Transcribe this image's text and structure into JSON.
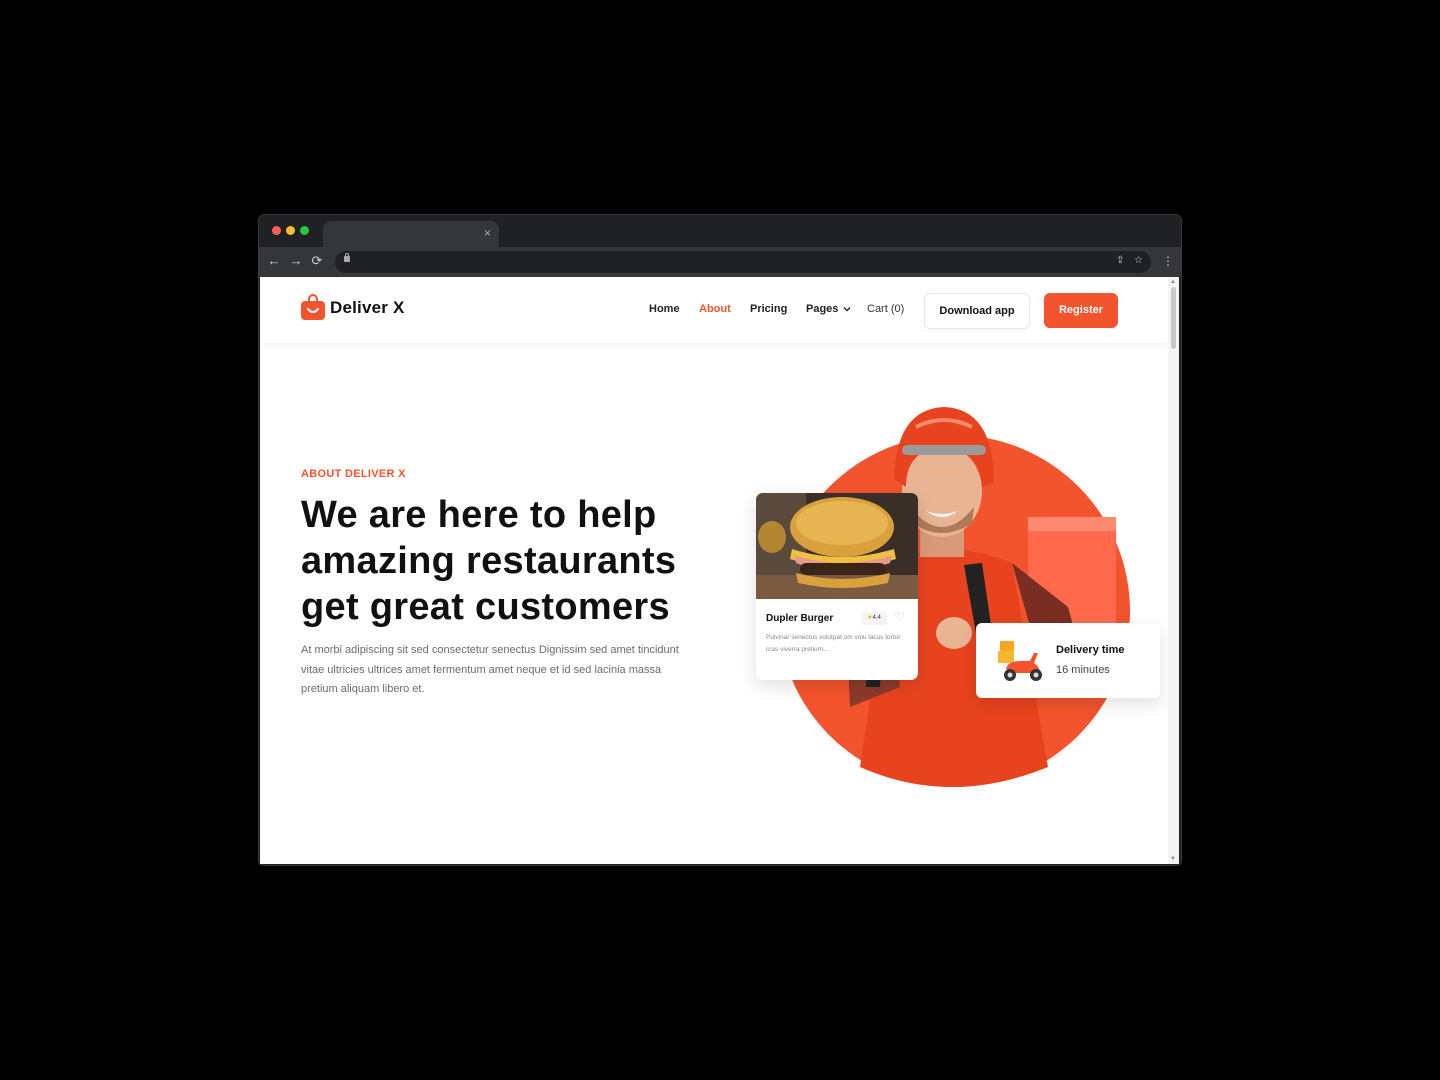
{
  "browser": {
    "tab_close": "×",
    "back_icon": "←",
    "forward_icon": "→",
    "reload_icon": "⟳",
    "share_icon": "⇪",
    "bookmark_icon": "☆",
    "menu_icon": "⋮"
  },
  "brand": {
    "name": "Deliver X",
    "accent_color": "#f2542d"
  },
  "nav": {
    "items": [
      {
        "label": "Home",
        "active": false
      },
      {
        "label": "About",
        "active": true
      },
      {
        "label": "Pricing",
        "active": false
      },
      {
        "label": "Pages",
        "active": false
      }
    ],
    "cart": "Cart (0)",
    "download_button": "Download app",
    "register_button": "Register"
  },
  "hero": {
    "eyebrow": "ABOUT DELIVER X",
    "headline": "We are here to help amazing restaurants get great customers",
    "lead": "At morbi adipiscing sit sed consectetur senectus Dignissim sed amet tincidunt vitae ultricies ultrices amet fermentum amet neque et id sed lacinia massa pretium aliquam libero et."
  },
  "food_card": {
    "title": "Dupler Burger",
    "rating": "4.4",
    "description": "Pulvinar senectus volutpat om volu lacus tortor cras viverra pretium..."
  },
  "delivery_card": {
    "title": "Delivery time",
    "value": "16 minutes"
  }
}
